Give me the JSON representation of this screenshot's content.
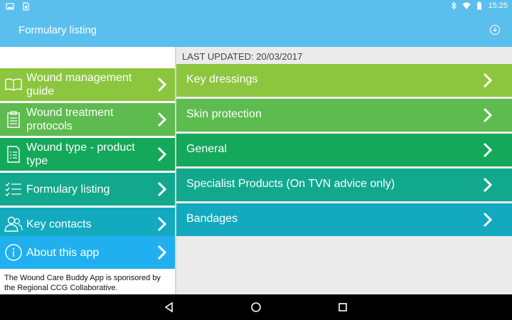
{
  "status_bar": {
    "time": "15:25",
    "icons": [
      "image-icon",
      "sim-icon",
      "bluetooth-icon",
      "wifi-icon",
      "battery-icon"
    ]
  },
  "app_bar": {
    "title": "Formulary listing",
    "action_icon": "download-icon"
  },
  "sidebar": {
    "items": [
      {
        "label": "Wound management guide",
        "icon": "book-icon",
        "color": "#8cc63f"
      },
      {
        "label": "Wound treatment protocols",
        "icon": "clipboard-icon",
        "color": "#5dbb4f"
      },
      {
        "label": "Wound type - product type",
        "icon": "document-list-icon",
        "color": "#14a85b"
      },
      {
        "label": "Formulary listing",
        "icon": "checklist-icon",
        "color": "#12a88e"
      },
      {
        "label": "Key contacts",
        "icon": "people-icon",
        "color": "#13aabf"
      },
      {
        "label": "About this app",
        "icon": "info-icon",
        "color": "#21b0ef"
      }
    ],
    "sponsor_text": "The Wound Care Buddy App is sponsored by the Regional CCG Collaborative."
  },
  "main": {
    "last_updated": "LAST UPDATED: 20/03/2017",
    "items": [
      {
        "label": "Key dressings",
        "color": "#8cc63f"
      },
      {
        "label": "Skin protection",
        "color": "#5dbb4f"
      },
      {
        "label": "General",
        "color": "#14a85b"
      },
      {
        "label": "Specialist Products (On TVN advice only)",
        "color": "#12a88e"
      },
      {
        "label": "Bandages",
        "color": "#13aabf"
      }
    ]
  },
  "nav_bar": {
    "icons": [
      "back-icon",
      "home-icon",
      "recents-icon"
    ]
  }
}
